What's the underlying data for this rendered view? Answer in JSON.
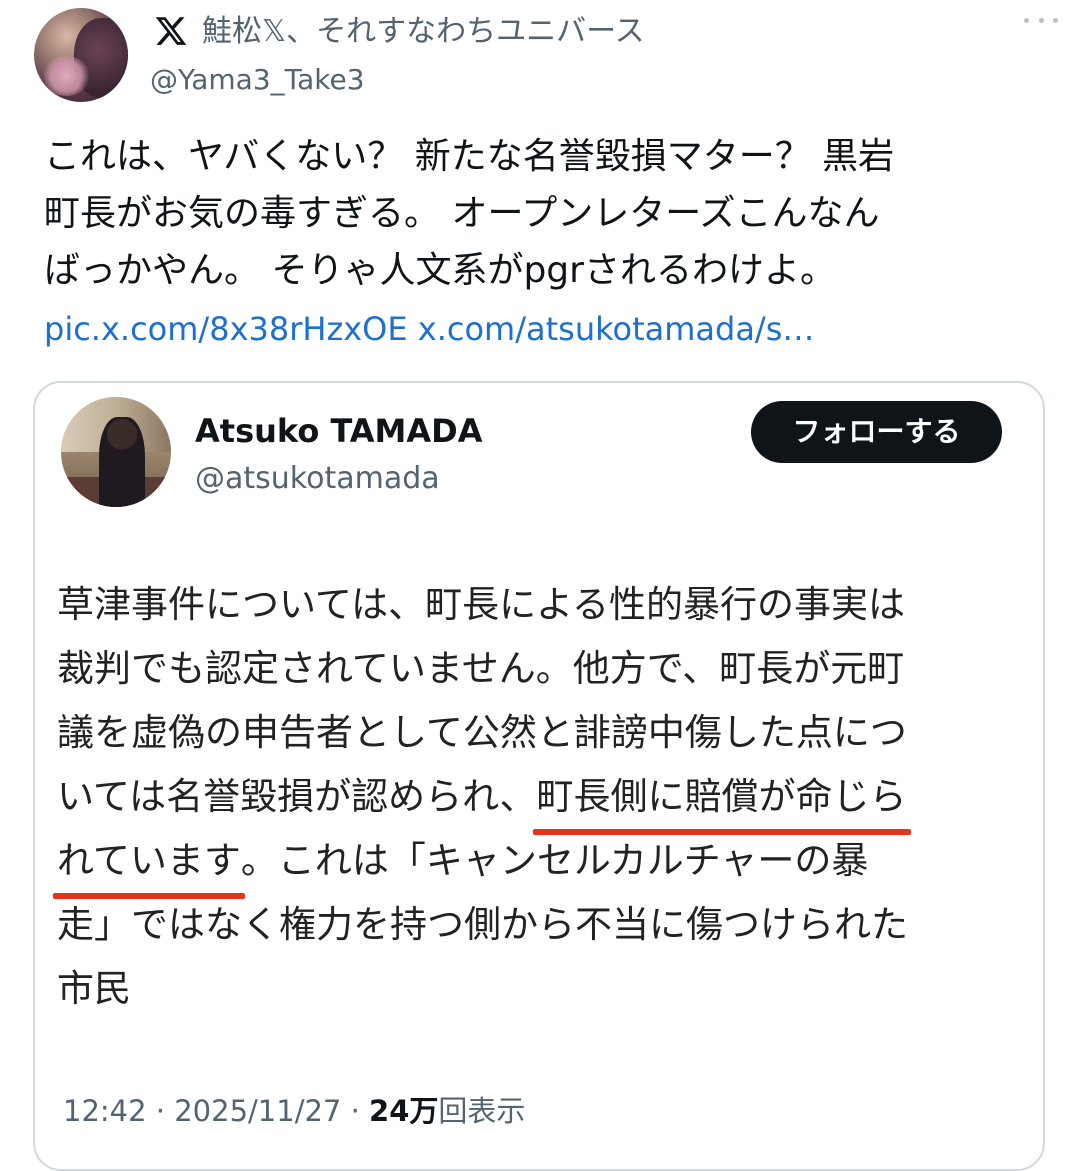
{
  "tweet": {
    "display_name": "鮭松𝕏、それすなわちユニバース",
    "handle": "@Yama3_Take3",
    "body_lines": [
      "これは、ヤバくない？ 新たな名誉毀損マター？ 黒岩",
      "町長がお気の毒すぎる。 オープンレターズこんなん",
      "ばっかやん。 そりゃ人文系がpgrされるわけよ。"
    ],
    "link_pic": "pic.x.com/8x38rHzxOE",
    "link_url": "x.com/atsukotamada/s…",
    "icons": {
      "logo": "x-logo-icon",
      "more": "more-icon"
    }
  },
  "quote": {
    "name": "Atsuko TAMADA",
    "handle": "@atsukotamada",
    "follow_label": "フォローする",
    "text": {
      "l1": "草津事件については、町長による性的暴行の事実は",
      "l2": "裁判でも認定されていません。他方で、町長が元町",
      "l3": "議を虚偽の申告者として公然と誹謗中傷した点につ",
      "l4a": "いては名誉毀損が認められ、",
      "l4b": "町長側に賠償が命じら",
      "l5a": "れています",
      "l5b": "。これは「キャンセルカルチャーの暴",
      "l6": "走」ではなく権力を持つ側から不当に傷つけられた",
      "l7": "市民"
    },
    "meta": {
      "time": "12:42",
      "sep1": " · ",
      "date": "2025/11/27",
      "sep2": " · ",
      "views_num": "24万",
      "views_label": "回表示"
    },
    "underline_color": "#e8321a"
  }
}
